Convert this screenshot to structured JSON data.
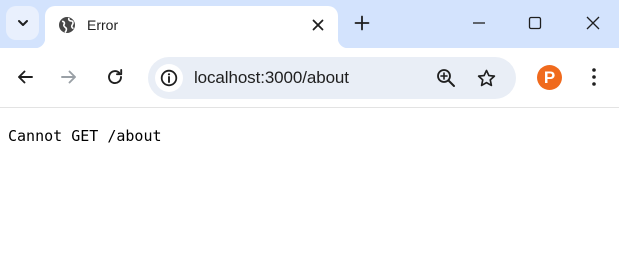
{
  "tab": {
    "title": "Error",
    "favicon": "globe-icon"
  },
  "window_controls": {
    "minimize": "minimize-icon",
    "maximize": "maximize-icon",
    "close": "close-icon"
  },
  "toolbar": {
    "back": "back-arrow-icon",
    "forward": "forward-arrow-icon",
    "reload": "reload-icon",
    "url": "localhost:3000/about",
    "zoom": "zoom-in-icon",
    "bookmark": "star-icon",
    "extension": "P",
    "menu": "more-vert-icon"
  },
  "colors": {
    "tabstrip": "#d3e3fd",
    "omnibox": "#e9eef6",
    "extension": "#f06a1d"
  },
  "page": {
    "message": "Cannot GET /about"
  }
}
